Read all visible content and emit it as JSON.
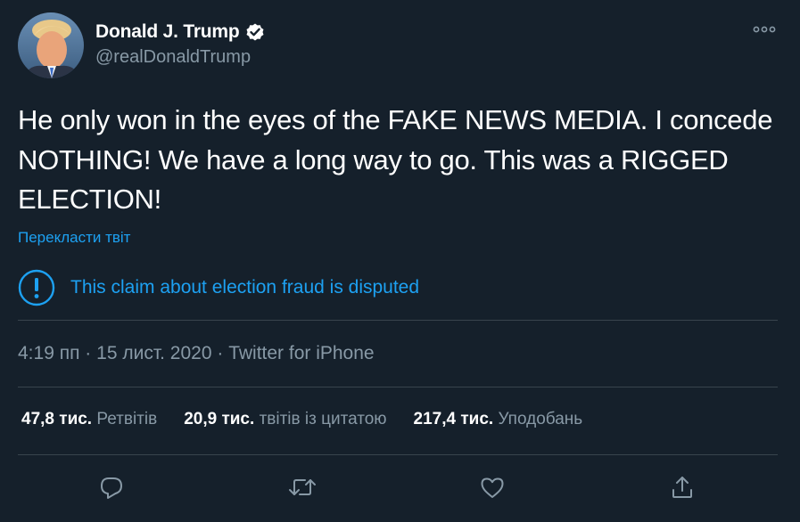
{
  "author": {
    "display_name": "Donald J. Trump",
    "handle": "@realDonaldTrump",
    "verified": true
  },
  "tweet": {
    "text": "He only won in the eyes of the FAKE NEWS MEDIA. I concede NOTHING! We have a long way to go. This was a RIGGED ELECTION!",
    "translate_label": "Перекласти твіт"
  },
  "notice": {
    "text": "This claim about election fraud is disputed",
    "icon": "info-exclamation-icon"
  },
  "meta": {
    "time": "4:19 пп",
    "separator": "·",
    "date": "15 лист. 2020",
    "source": "Twitter for iPhone"
  },
  "stats": {
    "retweets": {
      "value": "47,8 тис.",
      "label": "Ретвітів"
    },
    "quotes": {
      "value": "20,9 тис.",
      "label": "твітів із цитатою"
    },
    "likes": {
      "value": "217,4 тис.",
      "label": "Уподобань"
    }
  },
  "actions": [
    "reply-icon",
    "retweet-icon",
    "like-icon",
    "share-icon"
  ],
  "colors": {
    "background": "#15202b",
    "accent": "#1da1f2",
    "secondary_text": "#8899a6",
    "divider": "#38444d"
  }
}
